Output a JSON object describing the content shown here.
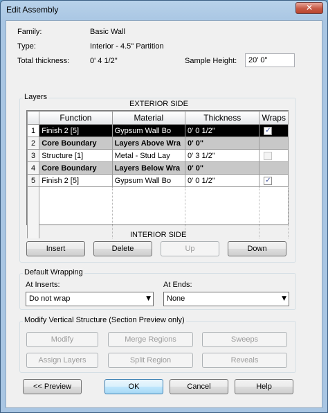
{
  "window": {
    "title": "Edit Assembly",
    "close_glyph": "✕"
  },
  "props": {
    "family_label": "Family:",
    "family_value": "Basic Wall",
    "type_label": "Type:",
    "type_value": "Interior - 4.5\" Partition",
    "thickness_label": "Total thickness:",
    "thickness_value": "0'  4 1/2\"",
    "sample_height_label": "Sample Height:",
    "sample_height_value": "20'  0\""
  },
  "layers": {
    "group_label": "Layers",
    "exterior_label": "EXTERIOR SIDE",
    "interior_label": "INTERIOR SIDE",
    "columns": [
      "Function",
      "Material",
      "Thickness",
      "Wraps"
    ],
    "rows": [
      {
        "num": "1",
        "function": "Finish 2 [5]",
        "material": "Gypsum Wall Bo",
        "thickness": "0'  0 1/2\"",
        "wraps": "checked"
      },
      {
        "num": "2",
        "function": "Core Boundary",
        "material": "Layers Above Wra",
        "thickness": "0'  0\"",
        "wraps": "none"
      },
      {
        "num": "3",
        "function": "Structure [1]",
        "material": "Metal - Stud Lay",
        "thickness": "0'  3 1/2\"",
        "wraps": "disabled"
      },
      {
        "num": "4",
        "function": "Core Boundary",
        "material": "Layers Below Wra",
        "thickness": "0'  0\"",
        "wraps": "none"
      },
      {
        "num": "5",
        "function": "Finish 2 [5]",
        "material": "Gypsum Wall Bo",
        "thickness": "0'  0 1/2\"",
        "wraps": "checked"
      }
    ],
    "check_glyph": "✓",
    "buttons": {
      "insert": "Insert",
      "delete": "Delete",
      "up": "Up",
      "down": "Down"
    }
  },
  "wrapping": {
    "group_label": "Default Wrapping",
    "inserts_label": "At Inserts:",
    "inserts_value": "Do not wrap",
    "ends_label": "At Ends:",
    "ends_value": "None",
    "arrow_glyph": "▼"
  },
  "vertical": {
    "group_label": "Modify Vertical Structure (Section Preview only)",
    "buttons": {
      "modify": "Modify",
      "merge_regions": "Merge Regions",
      "sweeps": "Sweeps",
      "assign_layers": "Assign Layers",
      "split_region": "Split Region",
      "reveals": "Reveals"
    }
  },
  "footer": {
    "preview": "<< Preview",
    "ok": "OK",
    "cancel": "Cancel",
    "help": "Help"
  }
}
